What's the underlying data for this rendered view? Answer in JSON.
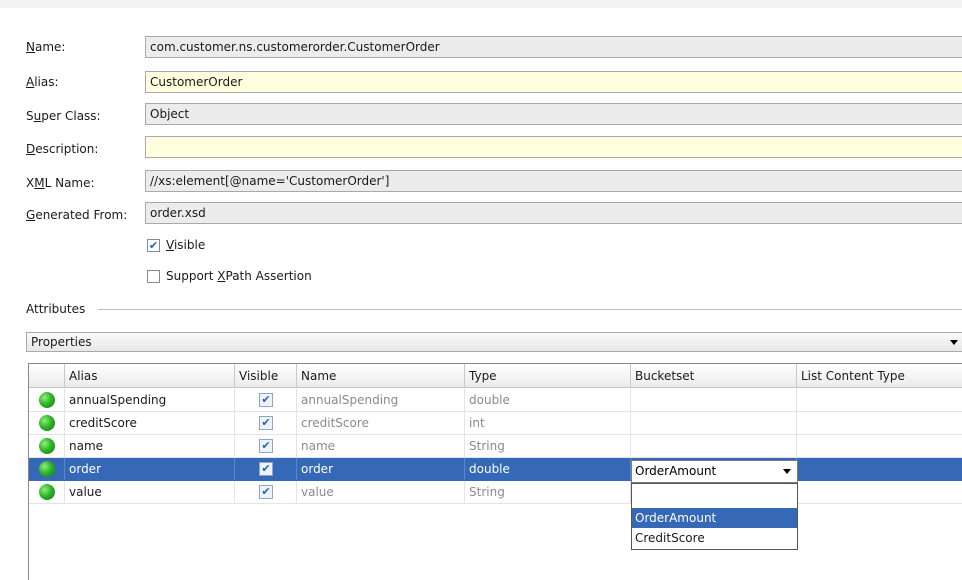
{
  "form": {
    "name": {
      "label_u": "N",
      "label_rest": "ame:",
      "value": "com.customer.ns.customerorder.CustomerOrder"
    },
    "alias": {
      "label_u": "A",
      "label_rest": "lias:",
      "value": "CustomerOrder"
    },
    "super_class": {
      "label_pre": "S",
      "label_u": "u",
      "label_rest": "per Class:",
      "value": "Object"
    },
    "description": {
      "label_u": "D",
      "label_rest": "escription:",
      "value": ""
    },
    "xml_name": {
      "label_pre": "X",
      "label_u": "M",
      "label_rest": "L Name:",
      "value": "//xs:element[@name='CustomerOrder']"
    },
    "generated_from": {
      "label_u": "G",
      "label_rest": "enerated From:",
      "value": "order.xsd"
    },
    "visible": {
      "u": "V",
      "rest": "isible",
      "checked": true
    },
    "xpath": {
      "pre": "Support ",
      "u": "X",
      "rest": "Path Assertion",
      "checked": false
    }
  },
  "attributes": {
    "section_title": "Attributes",
    "view_select": "Properties",
    "columns": [
      "Alias",
      "Visible",
      "Name",
      "Type",
      "Bucketset",
      "List Content Type"
    ],
    "rows": [
      {
        "alias": "annualSpending",
        "visible": true,
        "name": "annualSpending",
        "type": "double",
        "bucketset": "",
        "list_content_type": ""
      },
      {
        "alias": "creditScore",
        "visible": true,
        "name": "creditScore",
        "type": "int",
        "bucketset": "",
        "list_content_type": ""
      },
      {
        "alias": "name",
        "visible": true,
        "name": "name",
        "type": "String",
        "bucketset": "",
        "list_content_type": ""
      },
      {
        "alias": "order",
        "visible": true,
        "name": "order",
        "type": "double",
        "bucketset": "OrderAmount",
        "list_content_type": ""
      },
      {
        "alias": "value",
        "visible": true,
        "name": "value",
        "type": "String",
        "bucketset": "",
        "list_content_type": ""
      }
    ],
    "selected_row": 3
  },
  "bucketset_dropdown": {
    "selected": "OrderAmount",
    "options": [
      "",
      "OrderAmount",
      "CreditScore"
    ],
    "highlighted": 1
  },
  "colors": {
    "selection": "#3569b8",
    "field_yellow": "#ffffe0",
    "status_green": "#2fb52a"
  },
  "icons": {
    "row_status": "green-status-dot-icon",
    "check": "checkmark-icon",
    "dropdown": "chevron-down-icon"
  }
}
